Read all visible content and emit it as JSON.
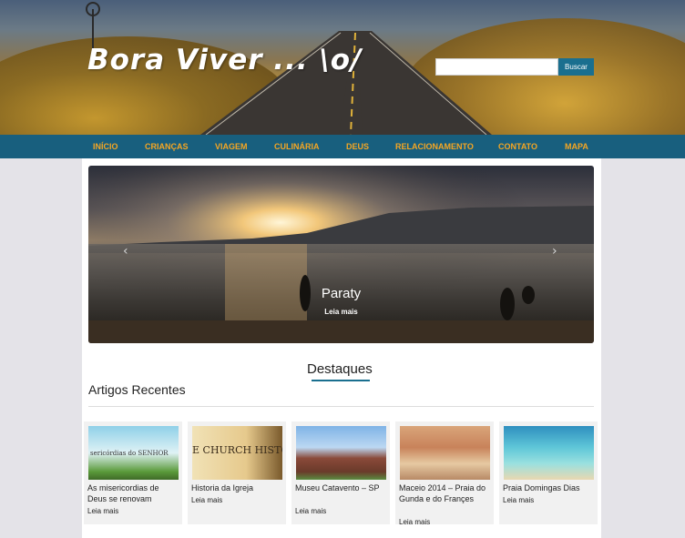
{
  "header": {
    "site_title": "Bora Viver ... \\o/",
    "search_placeholder": "",
    "search_button": "Buscar"
  },
  "nav": {
    "items": [
      "INÍCIO",
      "CRIANÇAS",
      "VIAGEM",
      "CULINÁRIA",
      "DEUS",
      "RELACIONAMENTO",
      "CONTATO",
      "MAPA"
    ]
  },
  "slider": {
    "title": "Paraty",
    "link": "Leia mais",
    "prev": "‹",
    "next": "›"
  },
  "sections": {
    "featured": "Destaques",
    "recent": "Artigos Recentes"
  },
  "articles": [
    {
      "title": "As misericordias de Deus se renovam",
      "link": "Leia mais",
      "thumb_text": "sericórdias do SENHOR"
    },
    {
      "title": "Historia da Igreja",
      "link": "Leia mais",
      "thumb_text": "E CHURCH HISTO"
    },
    {
      "title": "Museu Catavento – SP",
      "link": "Leia mais",
      "thumb_text": ""
    },
    {
      "title": "Maceio 2014 – Praia do Gunda e do Françes",
      "link": "Leia mais",
      "thumb_text": ""
    },
    {
      "title": "Praia Domingas Dias",
      "link": "Leia mais",
      "thumb_text": ""
    }
  ]
}
